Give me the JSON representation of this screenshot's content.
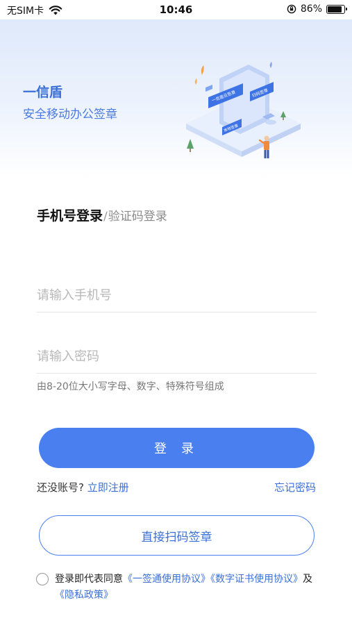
{
  "status_bar": {
    "carrier": "无SIM卡",
    "time": "10:46",
    "battery_percent_label": "86%",
    "battery_level": 0.86,
    "icons": [
      "wifi-icon",
      "rotation-lock-icon",
      "battery-icon"
    ]
  },
  "header": {
    "app_name": "一信盾",
    "slogan": "安全移动办公签章",
    "illustration_labels": [
      "一信盾云签章",
      "扫码签章",
      "本地签章"
    ]
  },
  "login": {
    "tab_active": "手机号登录",
    "tab_separator": "/",
    "tab_inactive": "验证码登录",
    "phone_placeholder": "请输入手机号",
    "password_placeholder": "请输入密码",
    "password_hint": "由8-20位大小写字母、数字、特殊符号组成",
    "login_button": "登 录",
    "no_account_text": "还没账号?",
    "register_link": "立即注册",
    "forgot_password": "忘记密码",
    "scan_sign_button": "直接扫码签章"
  },
  "agreement": {
    "prefix": "登录即代表同意",
    "link_usage": "《一签通使用协议》",
    "link_cert": "《数字证书使用协议》",
    "conjunction": "及",
    "link_privacy": "《隐私政策》"
  },
  "colors": {
    "accent": "#4a7ff0",
    "link": "#3a6fd8",
    "banner_top": "#dfe9fb"
  }
}
